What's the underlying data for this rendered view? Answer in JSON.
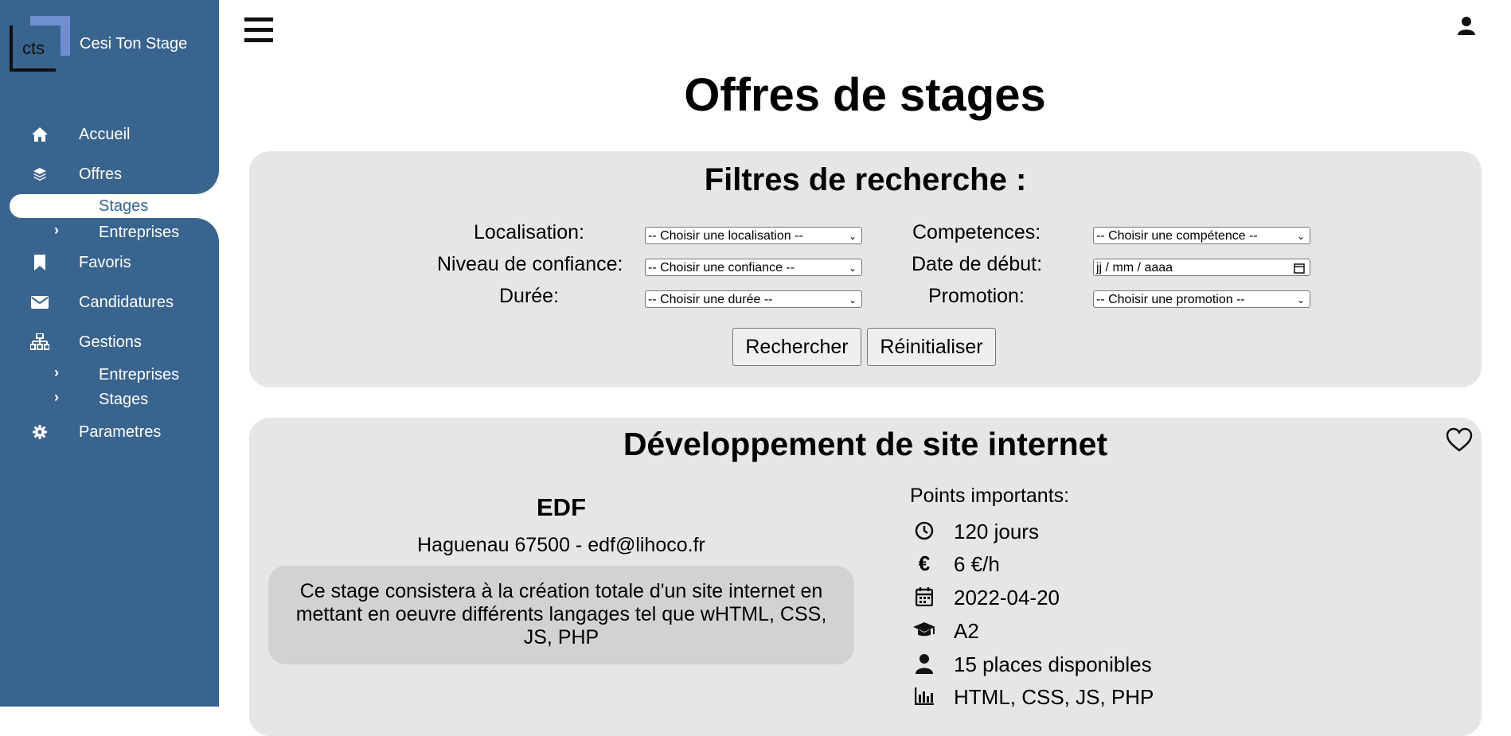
{
  "sidebar": {
    "logo_text": "cts",
    "brand": "Cesi Ton Stage",
    "items": [
      {
        "label": "Accueil",
        "icon": "home-icon"
      },
      {
        "label": "Offres",
        "icon": "layers-icon"
      },
      {
        "label": "Favoris",
        "icon": "bookmark-icon"
      },
      {
        "label": "Candidatures",
        "icon": "envelope-icon"
      },
      {
        "label": "Gestions",
        "icon": "sitemap-icon"
      },
      {
        "label": "Parametres",
        "icon": "gear-icon"
      }
    ],
    "offres_sub": [
      "Stages",
      "Entreprises"
    ],
    "gestions_sub": [
      "Entreprises",
      "Stages"
    ],
    "active_sub": "Stages"
  },
  "header": {
    "menu_icon": "hamburger-icon",
    "user_icon": "user-icon"
  },
  "page_title": "Offres de stages",
  "filters": {
    "title": "Filtres de recherche :",
    "localisation": {
      "label": "Localisation:",
      "value": "-- Choisir une localisation --"
    },
    "competences": {
      "label": "Competences:",
      "value": "-- Choisir une compétence --"
    },
    "confiance": {
      "label": "Niveau de confiance:",
      "value": "-- Choisir une confiance --"
    },
    "date_debut": {
      "label": "Date de début:",
      "value": "jj / mm / aaaa"
    },
    "duree": {
      "label": "Durée:",
      "value": "-- Choisir une durée --"
    },
    "promotion": {
      "label": "Promotion:",
      "value": "-- Choisir une promotion --"
    },
    "search_label": "Rechercher",
    "reset_label": "Réinitialiser"
  },
  "offer": {
    "title": "Développement de site internet",
    "company": "EDF",
    "contact": "Haguenau 67500 - edf@lihoco.fr",
    "description": "Ce stage consistera à la création totale d'un site internet en mettant en oeuvre différents langages tel que wHTML, CSS, JS, PHP",
    "points_title": "Points importants:",
    "duration": "120 jours",
    "pay": "6 €/h",
    "start_date": "2022-04-20",
    "promotion": "A2",
    "places": "15 places disponibles",
    "skills": "HTML, CSS, JS, PHP"
  }
}
